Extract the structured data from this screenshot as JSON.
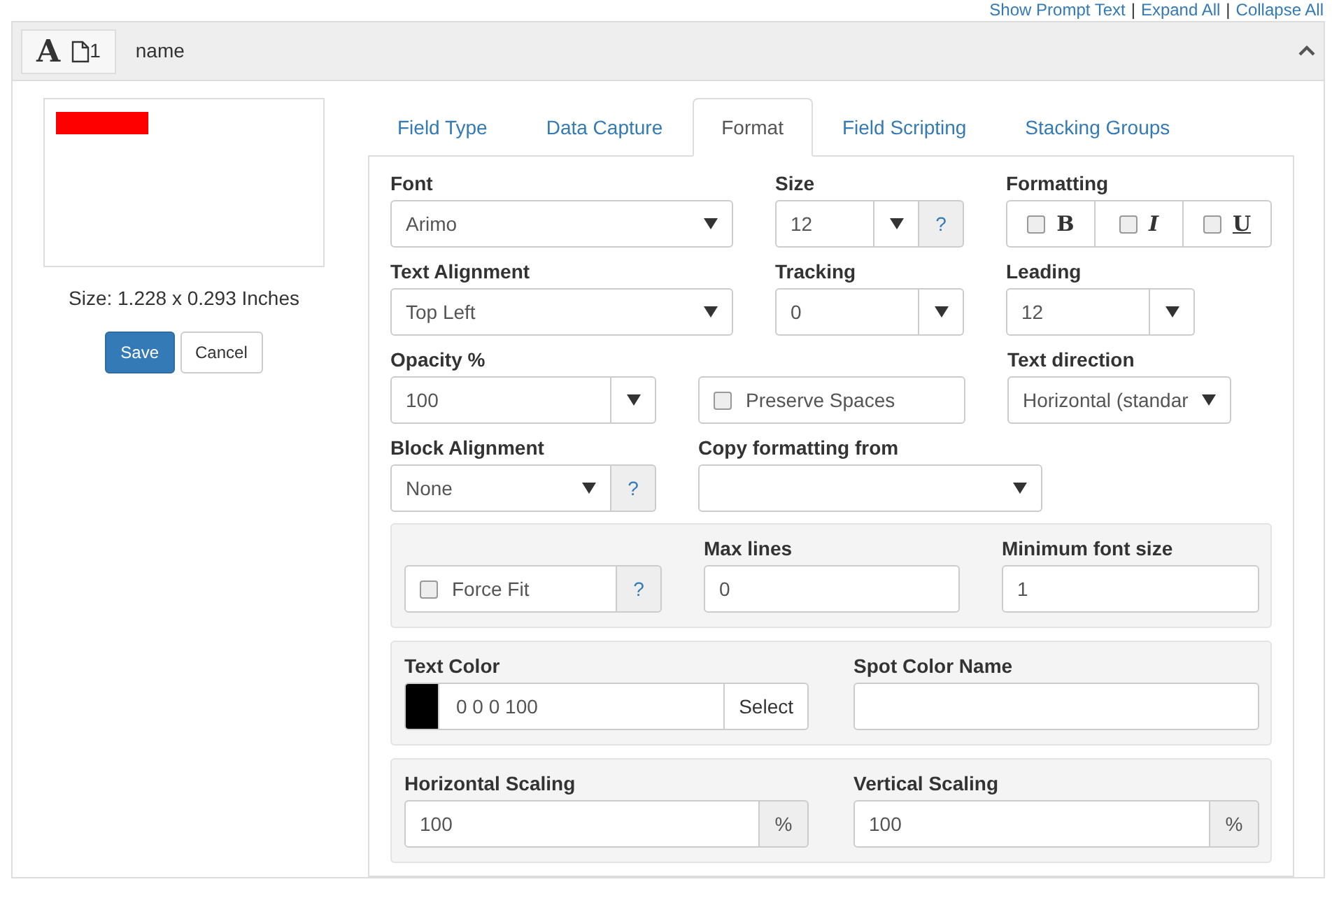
{
  "top_links": [
    {
      "kind": "link",
      "text": "Show Prompt Text"
    },
    {
      "kind": "separator",
      "text": "|"
    },
    {
      "kind": "link",
      "text": "Expand All"
    },
    {
      "kind": "separator",
      "text": "|"
    },
    {
      "kind": "link",
      "text": "Collapse All"
    }
  ],
  "header": {
    "type_glyph": "A",
    "page_count": "1",
    "title": "name",
    "expanded": true
  },
  "preview": {
    "size_text": "Size: 1.228 x 0.293 Inches"
  },
  "buttons": [
    {
      "label": "Save",
      "kind": "primary"
    },
    {
      "label": "Cancel",
      "kind": "default"
    }
  ],
  "tabs": [
    {
      "label": "Field Type",
      "selected": false
    },
    {
      "label": "Data Capture",
      "selected": false
    },
    {
      "label": "Format",
      "selected": true
    },
    {
      "label": "Field Scripting",
      "selected": false
    },
    {
      "label": "Stacking Groups",
      "selected": false
    }
  ],
  "rows": [
    [
      {
        "kind": "select",
        "label": "Font",
        "value": "Arimo"
      },
      {
        "kind": "combo",
        "label": "Size",
        "value": "12",
        "help": "?"
      },
      {
        "kind": "toggles",
        "label": "Formatting",
        "options": [
          {
            "glyph": "B",
            "checked": false
          },
          {
            "glyph": "I",
            "checked": false
          },
          {
            "glyph": "U",
            "checked": false
          }
        ]
      }
    ],
    [
      {
        "kind": "select",
        "label": "Text Alignment",
        "value": "Top Left"
      },
      {
        "kind": "combo",
        "label": "Tracking",
        "value": "0"
      },
      {
        "kind": "combo",
        "label": "Leading",
        "value": "12"
      }
    ],
    [
      {
        "kind": "combo",
        "label": "Opacity %",
        "value": "100"
      },
      {
        "kind": "checkbox",
        "text": "Preserve Spaces",
        "checked": false
      },
      {
        "kind": "select",
        "label": "Text direction",
        "value": "Horizontal (standar"
      }
    ],
    [
      {
        "kind": "select",
        "label": "Block Alignment",
        "value": "None",
        "help": "?"
      },
      {
        "kind": "select",
        "label": "Copy formatting from"
      }
    ]
  ],
  "sections": [
    [
      {
        "kind": "checkbox",
        "text": "Force Fit",
        "checked": false,
        "help": "?"
      },
      {
        "kind": "input",
        "label": "Max lines",
        "value": "0"
      },
      {
        "kind": "input",
        "label": "Minimum font size",
        "value": "1"
      }
    ],
    [
      {
        "kind": "color",
        "label": "Text Color",
        "value": "0 0 0 100",
        "color": "#000000",
        "button": "Select"
      },
      {
        "kind": "input",
        "label": "Spot Color Name"
      }
    ],
    [
      {
        "kind": "unit",
        "label": "Horizontal Scaling",
        "value": "100",
        "unit": "%"
      },
      {
        "kind": "unit",
        "label": "Vertical Scaling",
        "value": "100",
        "unit": "%"
      }
    ]
  ]
}
